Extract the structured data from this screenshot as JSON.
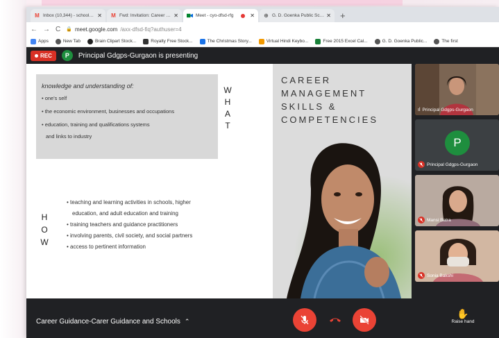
{
  "tabs": [
    {
      "label": "Inbox (10,344) - school@gdgoen",
      "icon": "gmail-icon",
      "active": false
    },
    {
      "label": "Fwd: Invitation: Career Guidance",
      "icon": "gmail-icon",
      "active": false
    },
    {
      "label": "Meet - cyo-dfsd-rfg",
      "icon": "meet-icon",
      "active": true,
      "recording": true
    },
    {
      "label": "G. D. Goenka Public School - G",
      "icon": "globe-icon",
      "active": false
    }
  ],
  "address": {
    "domain": "meet.google.com",
    "path": "/axx-dfsd-fiq?authuser=4"
  },
  "bookmarks": [
    {
      "label": "Apps",
      "color": "#4285f4"
    },
    {
      "label": "New Tab",
      "color": "#555"
    },
    {
      "label": "Brain Clipart Stock...",
      "color": "#222"
    },
    {
      "label": "Royalty Free Stock...",
      "color": "#333"
    },
    {
      "label": "The Christmas Story...",
      "color": "#1a73e8"
    },
    {
      "label": "Virtual Hindi Keybo...",
      "color": "#f29900"
    },
    {
      "label": "Free 2015 Excel Cal...",
      "color": "#188038"
    },
    {
      "label": "G. D. Goenka Public...",
      "color": "#555"
    },
    {
      "label": "The first",
      "color": "#555"
    }
  ],
  "meet": {
    "rec_label": "REC",
    "presenter_initial": "P",
    "presenting_text": "Principal Gdgps-Gurgaon is presenting"
  },
  "slide": {
    "what_intro": "knowledge and understanding of:",
    "what_items": [
      "• one's self",
      "• the economic environment, businesses and occupations",
      "• education, training and qualifications systems",
      "and links to industry"
    ],
    "what_letters": [
      "W",
      "H",
      "A",
      "T"
    ],
    "title_lines": [
      "CAREER",
      "MANAGEMENT",
      "SKILLS &",
      "COMPETENCIES"
    ],
    "how_letters": [
      "H",
      "O",
      "W"
    ],
    "how_items": [
      "• teaching and learning activities in  schools, higher",
      "education, and adult education and training",
      "• training teachers and guidance practitioners",
      "• involving parents, civil society, and social partners",
      "•  access to pertinent information"
    ]
  },
  "participants": [
    {
      "name": "Principal Gdgps-Gurgaon",
      "type": "video"
    },
    {
      "name": "Principal Gdgps-Gurgaon",
      "type": "avatar",
      "initial": "P",
      "muted": true
    },
    {
      "name": "Mansi Batra",
      "type": "video",
      "muted": true
    },
    {
      "name": "Sonia Bakshi",
      "type": "video",
      "muted": true
    }
  ],
  "bottom": {
    "meeting_name": "Career Guidance-Carer Guidance and Schools",
    "raise_hand": "Raise hand"
  },
  "colors": {
    "meet_bg": "#202124",
    "red": "#ea4335",
    "rec": "#d93025",
    "green_avatar": "#1e8e3e"
  }
}
